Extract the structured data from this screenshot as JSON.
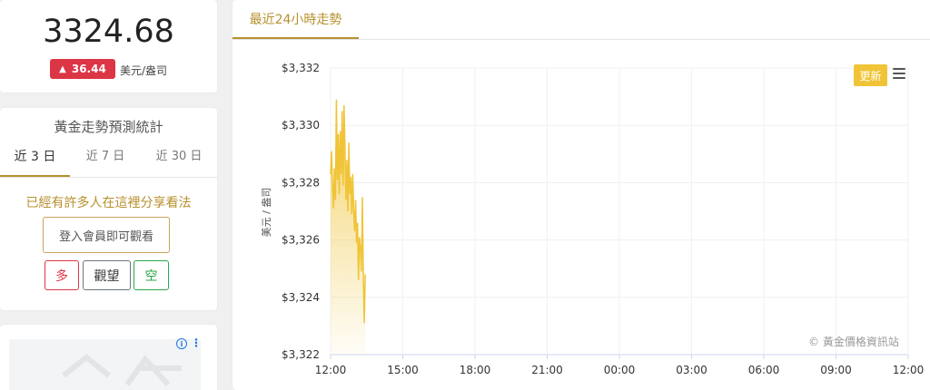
{
  "price_card": {
    "price": "3324.68",
    "change_arrow": "▲",
    "change": "36.44",
    "unit": "美元/盎司",
    "colors": {
      "badge": "#dc3545"
    }
  },
  "forecast": {
    "title": "黃金走勢預測統計",
    "tabs": [
      "近 3 日",
      "近 7 日",
      "近 30 日"
    ],
    "active_tab": "近 3 日",
    "share_text": "已經有許多人在這裡分享看法",
    "login_label": "登入會員即可觀看",
    "votes": {
      "long": "多",
      "watch": "觀望",
      "short": "空"
    },
    "colors": {
      "accent": "#b8902f",
      "long": "#dc3545",
      "short": "#28a745"
    }
  },
  "ad": {
    "info_icon": "info-icon",
    "kebab_icon": "kebab-icon"
  },
  "chart_panel": {
    "tab_label": "最近24小時走勢",
    "refresh_label": "更新",
    "menu_icon": "hamburger-icon",
    "watermark": "© 黃金價格資訊站"
  },
  "chart_data": {
    "type": "area",
    "ylabel": "美元 / 盎司",
    "ylim": [
      3322,
      3332
    ],
    "y_ticks": [
      {
        "value": 3332,
        "label": "$3,332"
      },
      {
        "value": 3330,
        "label": "$3,330"
      },
      {
        "value": 3328,
        "label": "$3,328"
      },
      {
        "value": 3326,
        "label": "$3,326"
      },
      {
        "value": 3324,
        "label": "$3,324"
      },
      {
        "value": 3322,
        "label": "$3,322"
      }
    ],
    "x_ticks": [
      "12:00",
      "15:00",
      "18:00",
      "21:00",
      "00:00",
      "03:00",
      "06:00",
      "09:00",
      "12:00"
    ],
    "xlim_hours": [
      0,
      24
    ],
    "grid": true,
    "series_color": "#f0c436",
    "x_hours": [
      0.0,
      0.04,
      0.08,
      0.12,
      0.16,
      0.2,
      0.24,
      0.28,
      0.32,
      0.36,
      0.4,
      0.44,
      0.48,
      0.52,
      0.56,
      0.6,
      0.64,
      0.68,
      0.72,
      0.76,
      0.8,
      0.84,
      0.88,
      0.92,
      0.96,
      1.0,
      1.04,
      1.08,
      1.12,
      1.16,
      1.2,
      1.24,
      1.28,
      1.32,
      1.36,
      1.4,
      1.44
    ],
    "values": [
      3328.3,
      3329.1,
      3328.0,
      3327.1,
      3328.5,
      3327.4,
      3330.9,
      3328.1,
      3329.7,
      3327.6,
      3329.8,
      3328.3,
      3330.5,
      3327.9,
      3330.7,
      3329.2,
      3327.4,
      3328.8,
      3327.0,
      3329.4,
      3327.6,
      3328.2,
      3326.9,
      3328.3,
      3327.1,
      3326.3,
      3327.4,
      3325.9,
      3326.6,
      3324.6,
      3326.1,
      3325.7,
      3324.9,
      3327.5,
      3324.8,
      3323.1,
      3324.8
    ]
  }
}
